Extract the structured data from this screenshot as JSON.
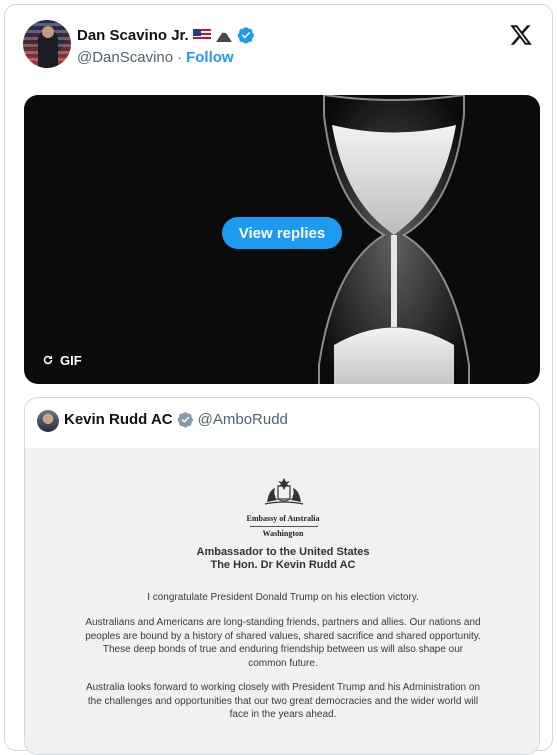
{
  "post": {
    "author_name": "Dan Scavino Jr.",
    "author_handle": "@DanScavino",
    "separator": "·",
    "follow_label": "Follow",
    "name_emojis": [
      "us-flag-emoji",
      "mountain-emoji"
    ],
    "verified_color": "#1d9bf0"
  },
  "media": {
    "view_replies_label": "View replies",
    "gif_label": "GIF"
  },
  "quote": {
    "author_name": "Kevin Rudd AC",
    "author_handle": "@AmboRudd",
    "verified_color": "#829aab",
    "letter": {
      "embassy_line": "Embassy of Australia",
      "city_line": "Washington",
      "title_line1": "Ambassador to the United States",
      "title_line2": "The Hon. Dr Kevin Rudd AC",
      "paragraph1": "I congratulate President Donald Trump on his election victory.",
      "paragraph2": "Australians and Americans are long-standing friends, partners and allies. Our nations and peoples are bound by a history of shared values, shared sacrifice and shared opportunity. These deep bonds of true and enduring friendship between us will also shape our common future.",
      "paragraph3": "Australia looks forward to working closely with President Trump and his Administration on the challenges and opportunities that our two great democracies and the wider world will face in the years ahead."
    }
  },
  "colors": {
    "accent": "#1d9bf0",
    "text_primary": "#0f1419",
    "text_secondary": "#536471",
    "border": "#cfd9de"
  }
}
